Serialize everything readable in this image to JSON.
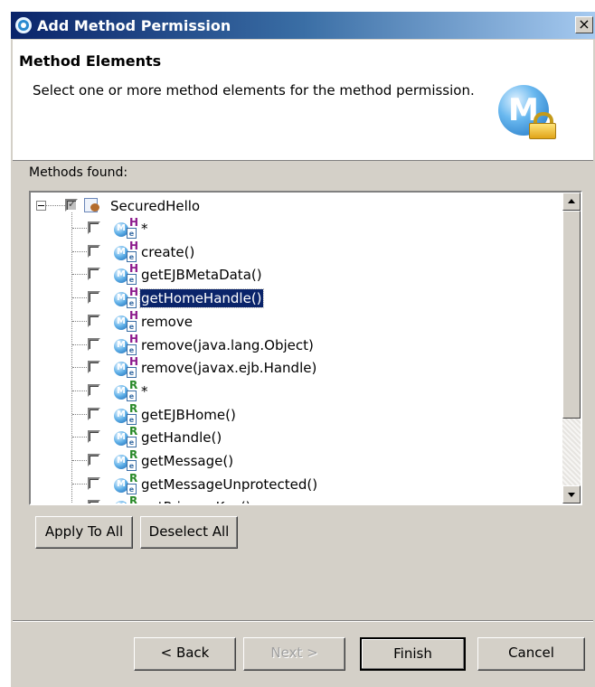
{
  "window": {
    "title": "Add Method Permission",
    "close_label": "×"
  },
  "header": {
    "title": "Method Elements",
    "description": "Select one or more method elements for the method permission.",
    "icon_letter": "M"
  },
  "tree": {
    "label": "Methods found:",
    "root": {
      "label": "SecuredHello",
      "checked": true,
      "expanded": true
    },
    "items": [
      {
        "label": "*",
        "interface": "H",
        "checked": false,
        "selected": false
      },
      {
        "label": "create()",
        "interface": "H",
        "checked": false,
        "selected": false
      },
      {
        "label": "getEJBMetaData()",
        "interface": "H",
        "checked": false,
        "selected": false
      },
      {
        "label": "getHomeHandle()",
        "interface": "H",
        "checked": false,
        "selected": true
      },
      {
        "label": "remove",
        "interface": "H",
        "checked": false,
        "selected": false
      },
      {
        "label": "remove(java.lang.Object)",
        "interface": "H",
        "checked": false,
        "selected": false
      },
      {
        "label": "remove(javax.ejb.Handle)",
        "interface": "H",
        "checked": false,
        "selected": false
      },
      {
        "label": "*",
        "interface": "R",
        "checked": false,
        "selected": false
      },
      {
        "label": "getEJBHome()",
        "interface": "R",
        "checked": false,
        "selected": false
      },
      {
        "label": "getHandle()",
        "interface": "R",
        "checked": false,
        "selected": false
      },
      {
        "label": "getMessage()",
        "interface": "R",
        "checked": false,
        "selected": false
      },
      {
        "label": "getMessageUnprotected()",
        "interface": "R",
        "checked": false,
        "selected": false
      },
      {
        "label": "getPrimaryKey()",
        "interface": "R",
        "checked": false,
        "selected": false
      }
    ]
  },
  "actions": {
    "apply_to_all": "Apply To All",
    "deselect_all": "Deselect All"
  },
  "footer": {
    "back": "< Back",
    "next": "Next >",
    "finish": "Finish",
    "cancel": "Cancel"
  },
  "colors": {
    "title_bar": "#0a246a",
    "dialog_bg": "#d4d0c8",
    "selection": "#0a246a"
  }
}
